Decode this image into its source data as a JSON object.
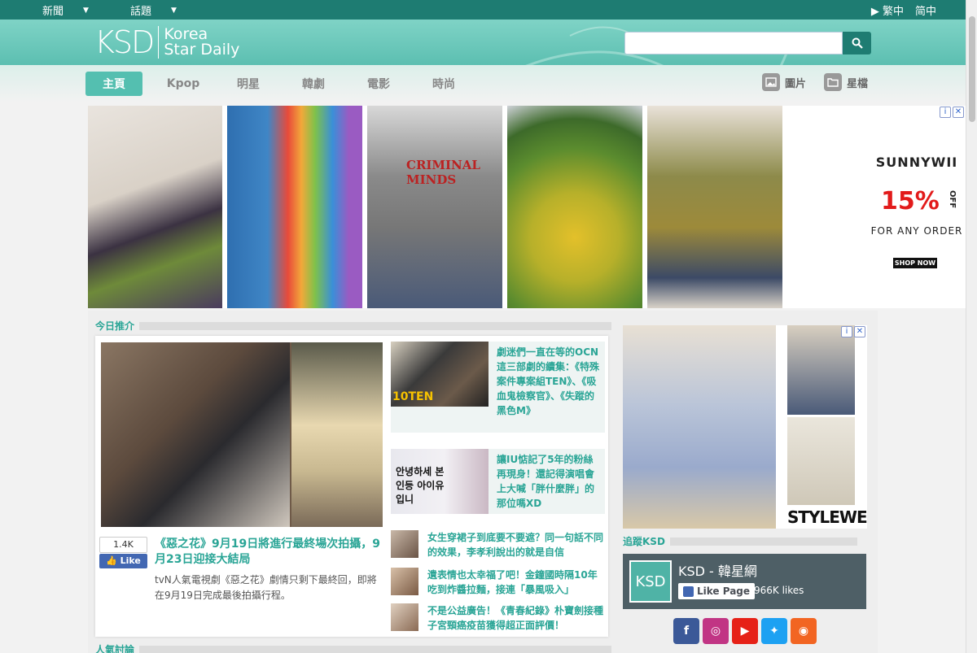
{
  "topbar": {
    "nav": [
      "新聞",
      "話題"
    ],
    "lang": [
      "▶ 繁中",
      "简中"
    ]
  },
  "logo": {
    "mark": "KSD",
    "line1": "Korea",
    "line2": "Star Daily"
  },
  "search": {
    "placeholder": ""
  },
  "nav": {
    "items": [
      "主頁",
      "Kpop",
      "明星",
      "韓劇",
      "電影",
      "時尚"
    ],
    "active": "主頁",
    "right": [
      {
        "label": "圖片",
        "icon": "image-icon"
      },
      {
        "label": "星檔",
        "icon": "folder-icon"
      }
    ]
  },
  "ad": {
    "brand": "SUNNYWII",
    "percent": "15%",
    "off": "OFF",
    "for_any": "FOR ANY ORDER",
    "cta": "SHOP NOW",
    "shirt_text": "CRIMINAL MINDS"
  },
  "today": {
    "title": "今日推介",
    "featured": {
      "likes": "1.4K",
      "like_label": "Like",
      "title": "《惡之花》9月19日將進行最終場次拍攝，9月23日迎接大結局",
      "summary": "tvN人氣電視劇《惡之花》劇情只剩下最終回，即將在9月19日完成最後拍攝行程。"
    },
    "side": [
      "劇迷們一直在等的OCN這三部劇的續集：《特殊案件專案組TEN》、《吸血鬼檢察官》、《失蹤的黑色M》",
      "讓IU惦記了5年的粉絲再現身！還記得演唱會上大喊「胖什麼胖」的那位嗎XD"
    ],
    "side_thumb_texts": [
      "10TEN",
      "안녕하세 본인등 아이유입니"
    ],
    "list": [
      "女生穿裙子到底要不要遮？同一句話不同的效果，李孝利說出的就是自信",
      "遺表情也太幸福了吧！金鐘國時隔10年吃到炸醬拉麵，接連「暴風吸入」",
      "不是公益廣告！《青春紀錄》朴寶劍接種子宮頸癌疫苗獲得超正面評價！"
    ]
  },
  "popular": {
    "title": "人氣討論"
  },
  "right_ad": {
    "brand": "STYLEWE"
  },
  "follow": {
    "title": "追蹤KSD",
    "page_name": "KSD - 韓星網",
    "like_page": "Like Page",
    "likes": "966K likes"
  },
  "social": [
    {
      "icon": "facebook-icon",
      "glyph": "f",
      "color": "#3b5998"
    },
    {
      "icon": "instagram-icon",
      "glyph": "◎",
      "color": "#c13584"
    },
    {
      "icon": "youtube-icon",
      "glyph": "▶",
      "color": "#e62117"
    },
    {
      "icon": "twitter-icon",
      "glyph": "✦",
      "color": "#1da1f2"
    },
    {
      "icon": "rss-icon",
      "glyph": "◉",
      "color": "#f26522"
    }
  ]
}
